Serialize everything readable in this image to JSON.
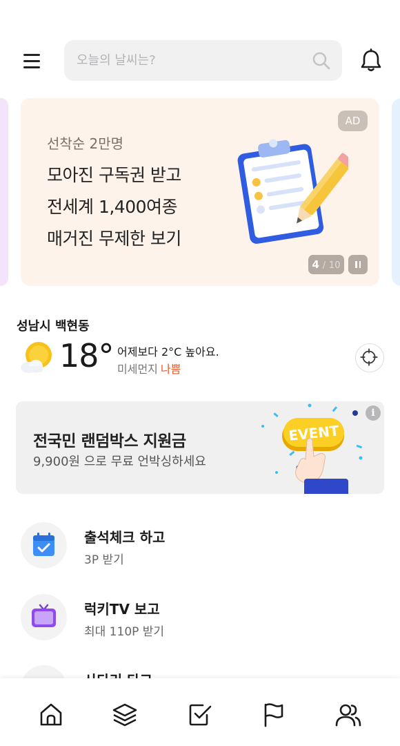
{
  "header": {
    "search_placeholder": "오늘의 날씨는?",
    "icons": {
      "menu": "hamburger-menu-icon",
      "search": "search-icon",
      "notifications": "bell-icon"
    }
  },
  "ad": {
    "subtitle": "선착순 2만명",
    "lines": [
      "모아진 구독권 받고",
      "전세계 1,400여종",
      "매거진 무제한 보기"
    ],
    "badge": "AD",
    "page_current": "4",
    "page_separator": "/",
    "page_total": "10",
    "illustration": "clipboard-checklist-pencil",
    "colors": {
      "card_bg": "#fef3ea",
      "peek_left": "#f3e3fb",
      "peek_right": "#e5f1fd"
    }
  },
  "weather": {
    "location": "성남시 백현동",
    "temperature": "18°",
    "compare": "어제보다 2°C 높아요.",
    "dust_label": "미세먼지",
    "dust_value": "나쁨",
    "icon": "sun-cloud-icon",
    "colors": {
      "dust_bad": "#e8592a"
    }
  },
  "event": {
    "title": "전국민 랜덤박스 지원금",
    "subtitle": "9,900원 으로 무료 언박싱하세요",
    "info": "i",
    "button_text": "EVENT"
  },
  "missions": [
    {
      "title": "출석체크 하고",
      "subtitle": "3P 받기",
      "icon": "calendar-check-icon"
    },
    {
      "title": "럭키TV 보고",
      "subtitle": "최대 110P 받기",
      "icon": "tv-icon"
    },
    {
      "title": "사다리 타고",
      "subtitle": "",
      "icon": "ladder-icon"
    }
  ],
  "bottom_nav": [
    {
      "name": "home",
      "icon": "home-icon"
    },
    {
      "name": "layers",
      "icon": "layers-icon"
    },
    {
      "name": "checklist",
      "icon": "check-square-icon"
    },
    {
      "name": "flag",
      "icon": "flag-icon"
    },
    {
      "name": "friends",
      "icon": "users-icon"
    }
  ]
}
